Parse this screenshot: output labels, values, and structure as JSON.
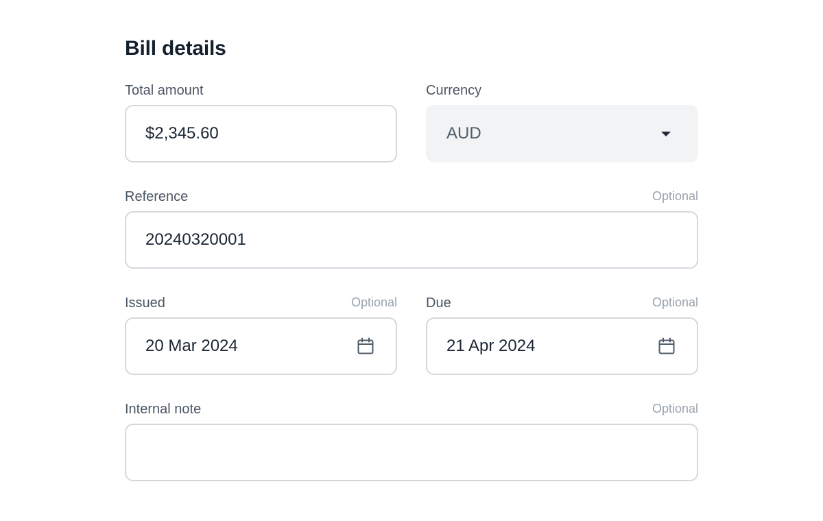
{
  "form": {
    "title": "Bill details",
    "optional_label": "Optional",
    "total_amount": {
      "label": "Total amount",
      "value": "$2,345.60"
    },
    "currency": {
      "label": "Currency",
      "value": "AUD"
    },
    "reference": {
      "label": "Reference",
      "value": "20240320001",
      "optional": "Optional"
    },
    "issued": {
      "label": "Issued",
      "value": "20 Mar 2024",
      "optional": "Optional"
    },
    "due": {
      "label": "Due",
      "value": "21 Apr 2024",
      "optional": "Optional"
    },
    "internal_note": {
      "label": "Internal note",
      "value": "",
      "optional": "Optional"
    }
  },
  "icons": {
    "calendar": "calendar-icon",
    "dropdown": "chevron-down-icon"
  },
  "colors": {
    "text": "#1a2634",
    "label": "#4a5563",
    "muted": "#9aa3ad",
    "border": "#d4d8dd",
    "select_bg": "#f1f3f5"
  }
}
